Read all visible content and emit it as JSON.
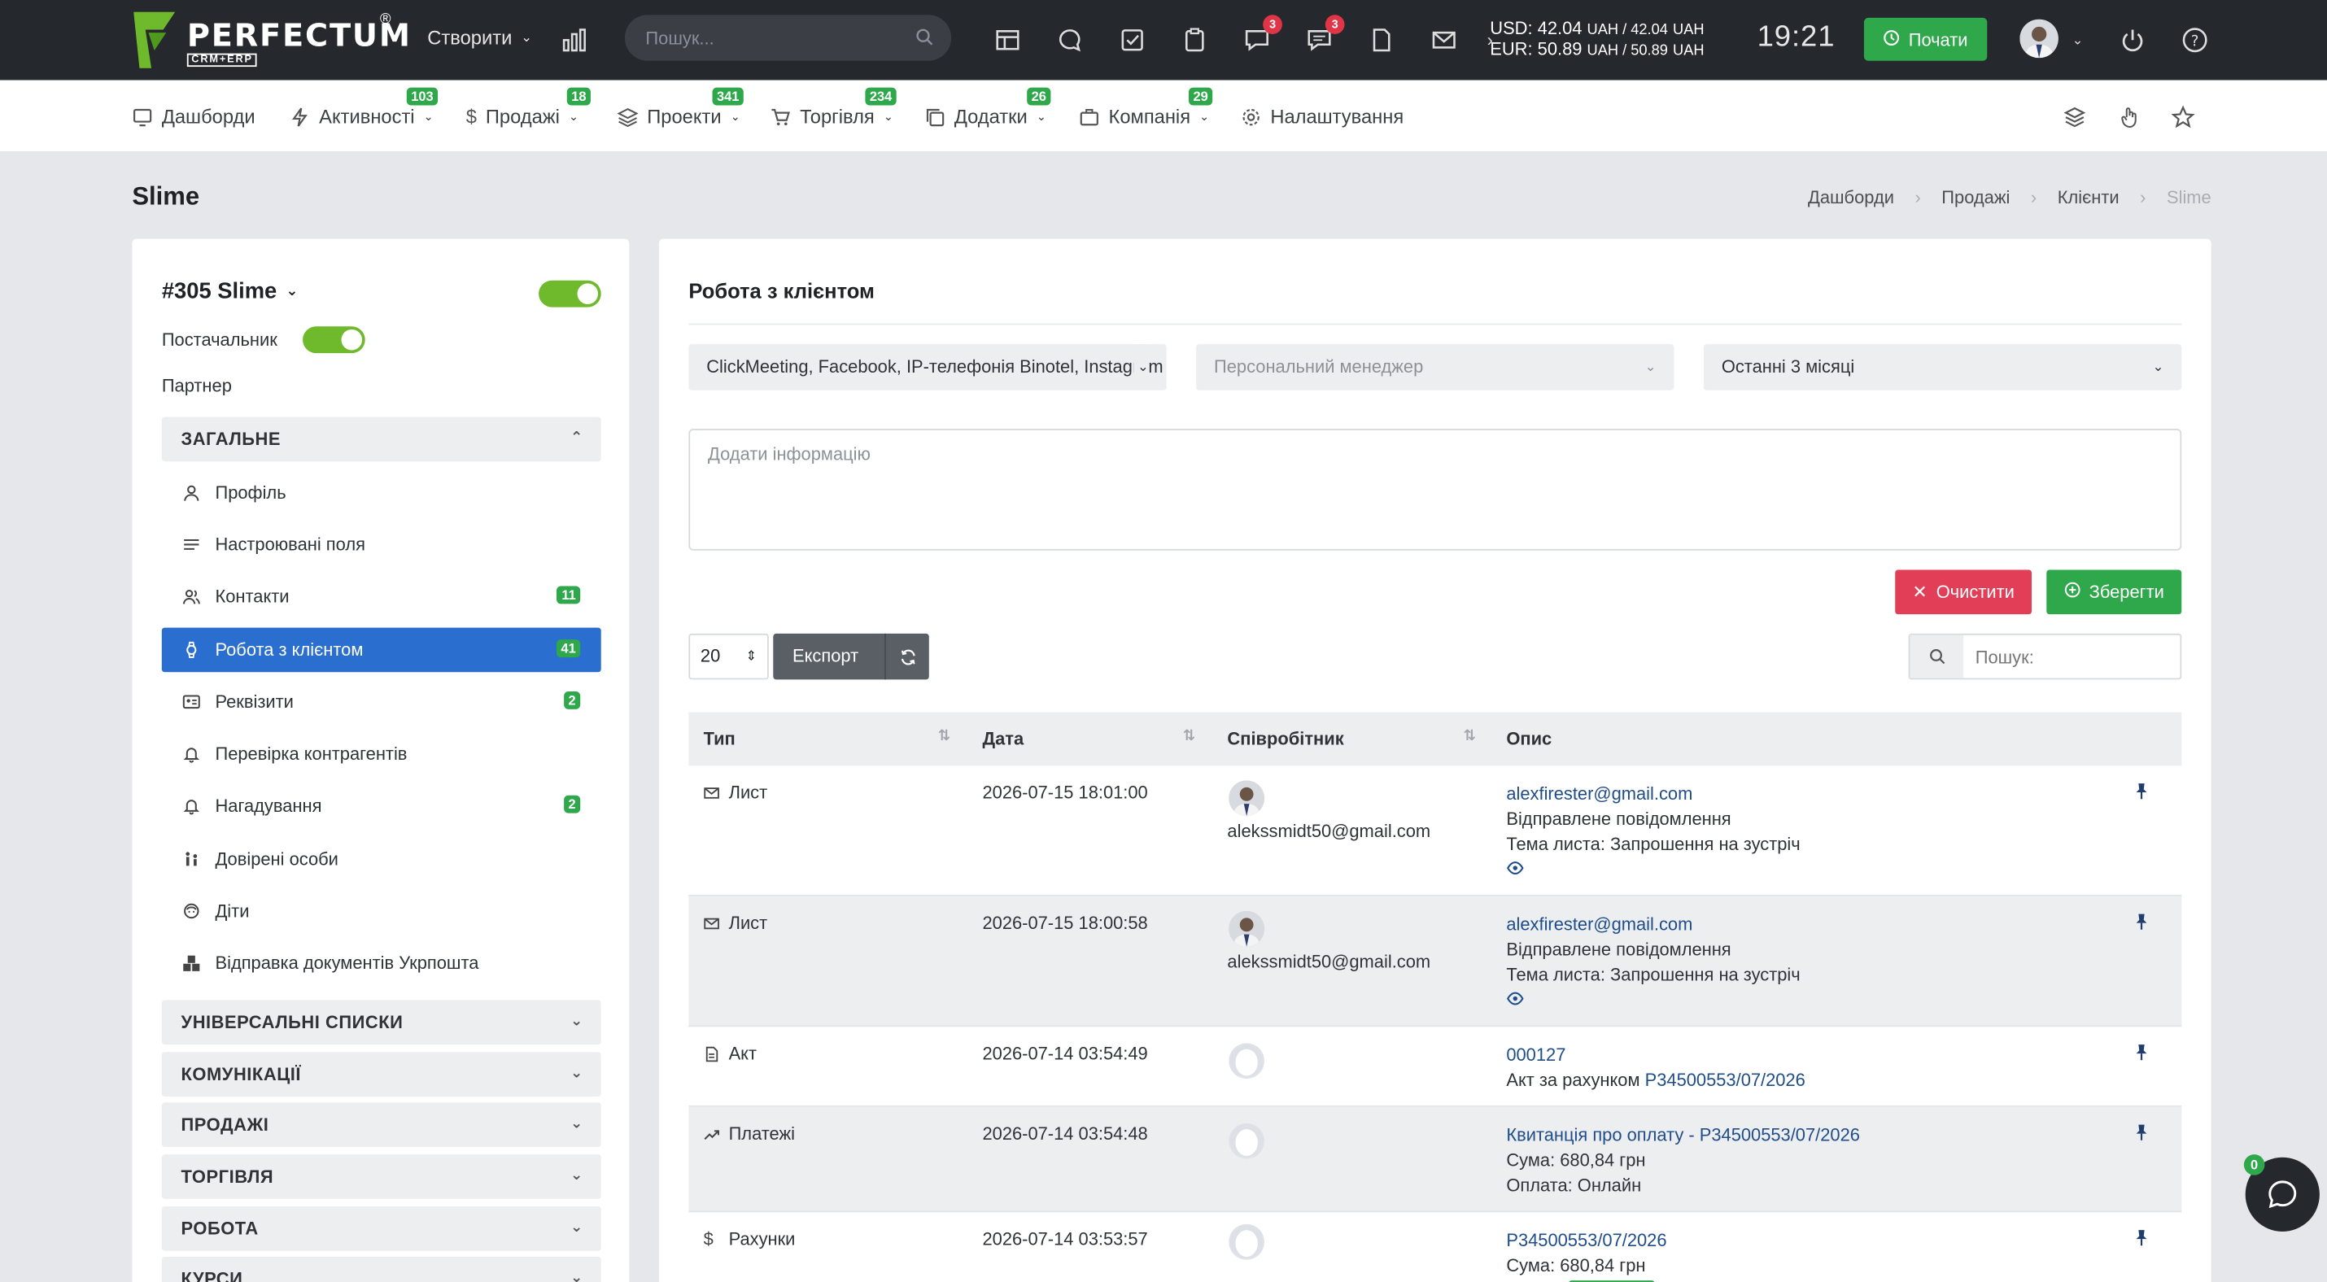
{
  "app": {
    "logo_text": "PERFECTUM",
    "logo_sub": "CRM+ERP",
    "logo_reg": "®",
    "create_label": "Створити",
    "search_placeholder": "Пошук...",
    "badges": {
      "chat1": "3",
      "chat2": "3"
    },
    "currency_usd": "USD: 42.04",
    "currency_usd_rest": "UAH / 42.04",
    "currency_eur": "EUR: 50.89",
    "currency_eur_rest": "UAH / 50.89",
    "uah": "UAH",
    "clock": "19:21",
    "start_label": "Почати"
  },
  "nav": {
    "items": [
      {
        "label": "Дашборди",
        "badge": ""
      },
      {
        "label": "Активності",
        "badge": "103"
      },
      {
        "label": "Продажі",
        "badge": "18"
      },
      {
        "label": "Проекти",
        "badge": "341"
      },
      {
        "label": "Торгівля",
        "badge": "234"
      },
      {
        "label": "Додатки",
        "badge": "26"
      },
      {
        "label": "Компанія",
        "badge": "29"
      },
      {
        "label": "Налаштування",
        "badge": ""
      }
    ]
  },
  "page": {
    "title": "Slime",
    "breadcrumb": [
      "Дашборди",
      "Продажі",
      "Клієнти",
      "Slime"
    ]
  },
  "client": {
    "name": "#305 Slime",
    "supplier_label": "Постачальник",
    "partner_label": "Партнер",
    "section_general": "ЗАГАЛЬНЕ",
    "menu": [
      {
        "label": "Профіль",
        "badge": ""
      },
      {
        "label": "Настроювані поля",
        "badge": ""
      },
      {
        "label": "Контакти",
        "badge": "11"
      },
      {
        "label": "Робота з клієнтом",
        "badge": "41"
      },
      {
        "label": "Реквізити",
        "badge": "2"
      },
      {
        "label": "Перевірка контрагентів",
        "badge": ""
      },
      {
        "label": "Нагадування",
        "badge": "2"
      },
      {
        "label": "Довірені особи",
        "badge": ""
      },
      {
        "label": "Діти",
        "badge": ""
      },
      {
        "label": "Відправка документів Укрпошта",
        "badge": ""
      }
    ],
    "sections": [
      "УНІВЕРСАЛЬНІ СПИСКИ",
      "КОМУНІКАЦІЇ",
      "ПРОДАЖІ",
      "ТОРГІВЛЯ",
      "РОБОТА",
      "КУРСИ"
    ]
  },
  "work": {
    "title": "Робота з клієнтом",
    "filter_sources": "ClickMeeting, Facebook, IP-телефонія Binotel, Instagram",
    "filter_manager_placeholder": "Персональний менеджер",
    "filter_period": "Останні 3 місяці",
    "note_placeholder": "Додати інформацію",
    "clear_label": "Очистити",
    "save_label": "Зберегти",
    "per_page": "20",
    "export_label": "Експорт",
    "search_placeholder": "Пошук:",
    "columns": [
      "Тип",
      "Дата",
      "Співробітник",
      "Опис"
    ],
    "rows": [
      {
        "type": "Лист",
        "icon": "mail-icon",
        "date": "2026-07-15 18:01:00",
        "employee": "alekssmidt50@gmail.com",
        "avatar": "photo",
        "desc_link": "alexfirester@gmail.com",
        "desc_lines": [
          "Відправлене повідомлення",
          "Тема листа: Запрошення на зустріч"
        ],
        "eye": true
      },
      {
        "type": "Лист",
        "icon": "mail-icon",
        "date": "2026-07-15 18:00:58",
        "employee": "alekssmidt50@gmail.com",
        "avatar": "photo",
        "desc_link": "alexfirester@gmail.com",
        "desc_lines": [
          "Відправлене повідомлення",
          "Тема листа: Запрошення на зустріч"
        ],
        "eye": true
      },
      {
        "type": "Акт",
        "icon": "document-icon",
        "date": "2026-07-14 03:54:49",
        "employee": "",
        "avatar": "blank",
        "desc_link": "000127",
        "desc_lines": [
          "Акт за рахунком "
        ],
        "desc_inline_link": "P34500553/07/2026",
        "eye": false
      },
      {
        "type": "Платежі",
        "icon": "trend-icon",
        "date": "2026-07-14 03:54:48",
        "employee": "",
        "avatar": "blank",
        "desc_link": "Квитанція про оплату - P34500553/07/2026",
        "desc_lines": [
          "Сума: 680,84 грн",
          "Оплата: Онлайн"
        ],
        "eye": false
      },
      {
        "type": "Рахунки",
        "icon": "dollar-icon",
        "date": "2026-07-14 03:53:57",
        "employee": "",
        "avatar": "blank",
        "desc_link": "P34500553/07/2026",
        "desc_lines": [
          "Сума: 680,84 грн"
        ],
        "eye": false
      }
    ]
  },
  "chat": {
    "badge": "0"
  },
  "colors": {
    "topbar": "#25282c",
    "green": "#2ea84b",
    "red": "#e23e57",
    "blue": "#2a6ecf"
  }
}
